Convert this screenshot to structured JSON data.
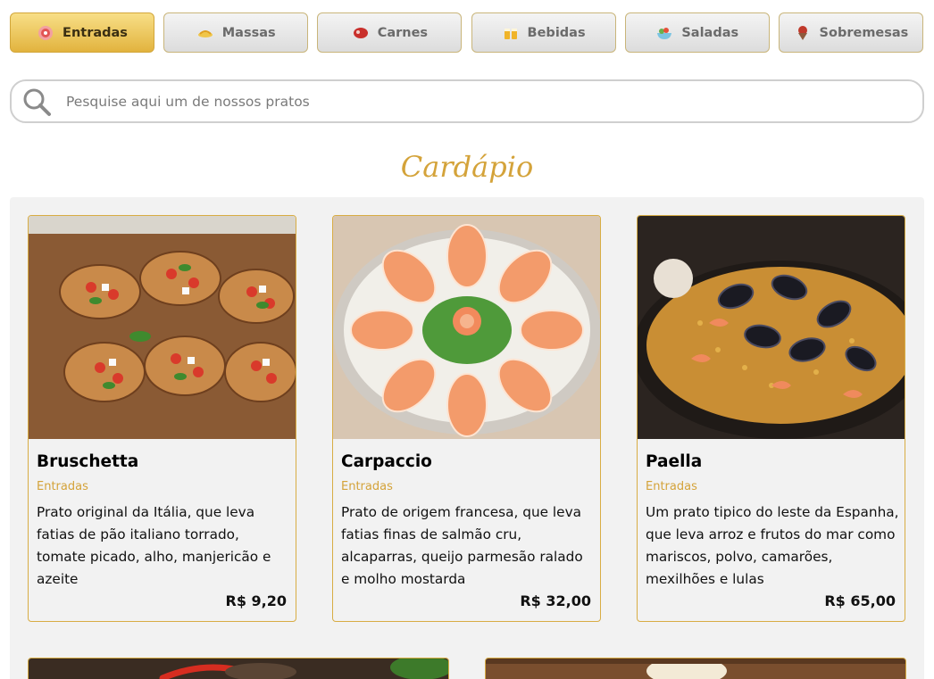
{
  "tabs": [
    {
      "label": "Entradas",
      "icon": "starter-icon",
      "active": true
    },
    {
      "label": "Massas",
      "icon": "pasta-icon",
      "active": false
    },
    {
      "label": "Carnes",
      "icon": "meat-icon",
      "active": false
    },
    {
      "label": "Bebidas",
      "icon": "drinks-icon",
      "active": false
    },
    {
      "label": "Saladas",
      "icon": "salad-icon",
      "active": false
    },
    {
      "label": "Sobremesas",
      "icon": "dessert-icon",
      "active": false
    }
  ],
  "search": {
    "placeholder": "Pesquise aqui um de nossos pratos",
    "value": ""
  },
  "section_title": "Cardápio",
  "colors": {
    "accent": "#d4a33a",
    "active_tab": "#e9c25a",
    "panel": "#f2f2f2"
  },
  "dishes": [
    {
      "name": "Bruschetta",
      "category": "Entradas",
      "description": "Prato original da Itália, que leva fatias de pão italiano torrado, tomate picado, alho, manjericão e azeite",
      "price": "R$ 9,20"
    },
    {
      "name": "Carpaccio",
      "category": "Entradas",
      "description": "Prato de origem francesa, que leva fatias finas de salmão cru, alcaparras, queijo parmesão ralado e molho mostarda",
      "price": "R$ 32,00"
    },
    {
      "name": "Paella",
      "category": "Entradas",
      "description": "Um prato tipico do leste da Espanha, que leva arroz e frutos do mar como mariscos, polvo, camarões, mexilhões e lulas",
      "price": "R$ 65,00"
    }
  ]
}
